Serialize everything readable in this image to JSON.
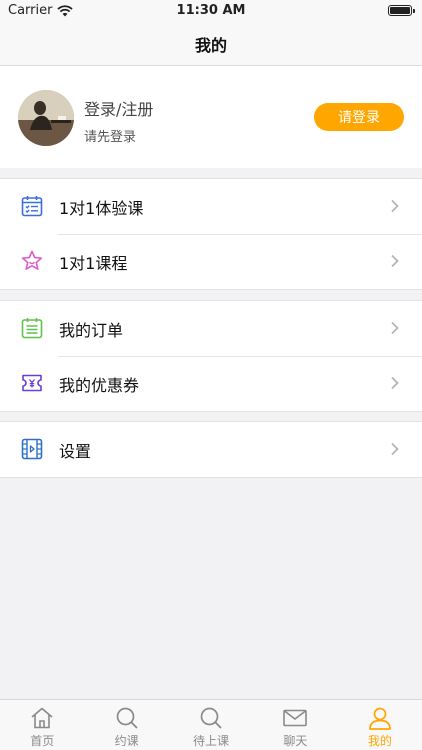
{
  "status_bar": {
    "carrier": "Carrier",
    "time": "11:30 AM"
  },
  "nav": {
    "title": "我的"
  },
  "profile": {
    "title": "登录/注册",
    "subtitle": "请先登录",
    "login_button": "请登录"
  },
  "menu_groups": [
    [
      {
        "label": "1对1体验课",
        "icon": "calendar-checklist-icon"
      },
      {
        "label": "1对1课程",
        "icon": "star-icon"
      }
    ],
    [
      {
        "label": "我的订单",
        "icon": "order-list-icon"
      },
      {
        "label": "我的优惠券",
        "icon": "coupon-yen-icon"
      }
    ],
    [
      {
        "label": "设置",
        "icon": "settings-video-icon"
      }
    ]
  ],
  "tabs": [
    {
      "label": "首页",
      "icon": "home-icon",
      "active": false
    },
    {
      "label": "约课",
      "icon": "search-icon",
      "active": false
    },
    {
      "label": "待上课",
      "icon": "search-icon",
      "active": false
    },
    {
      "label": "聊天",
      "icon": "mail-icon",
      "active": false
    },
    {
      "label": "我的",
      "icon": "person-icon",
      "active": true
    }
  ],
  "colors": {
    "accent": "#ffa600",
    "calendar_icon": "#3b6fd8",
    "star_icon": "#e05bc8",
    "order_icon": "#5fc24b",
    "coupon_icon": "#6b3fd6",
    "settings_icon": "#2f6fc9"
  }
}
